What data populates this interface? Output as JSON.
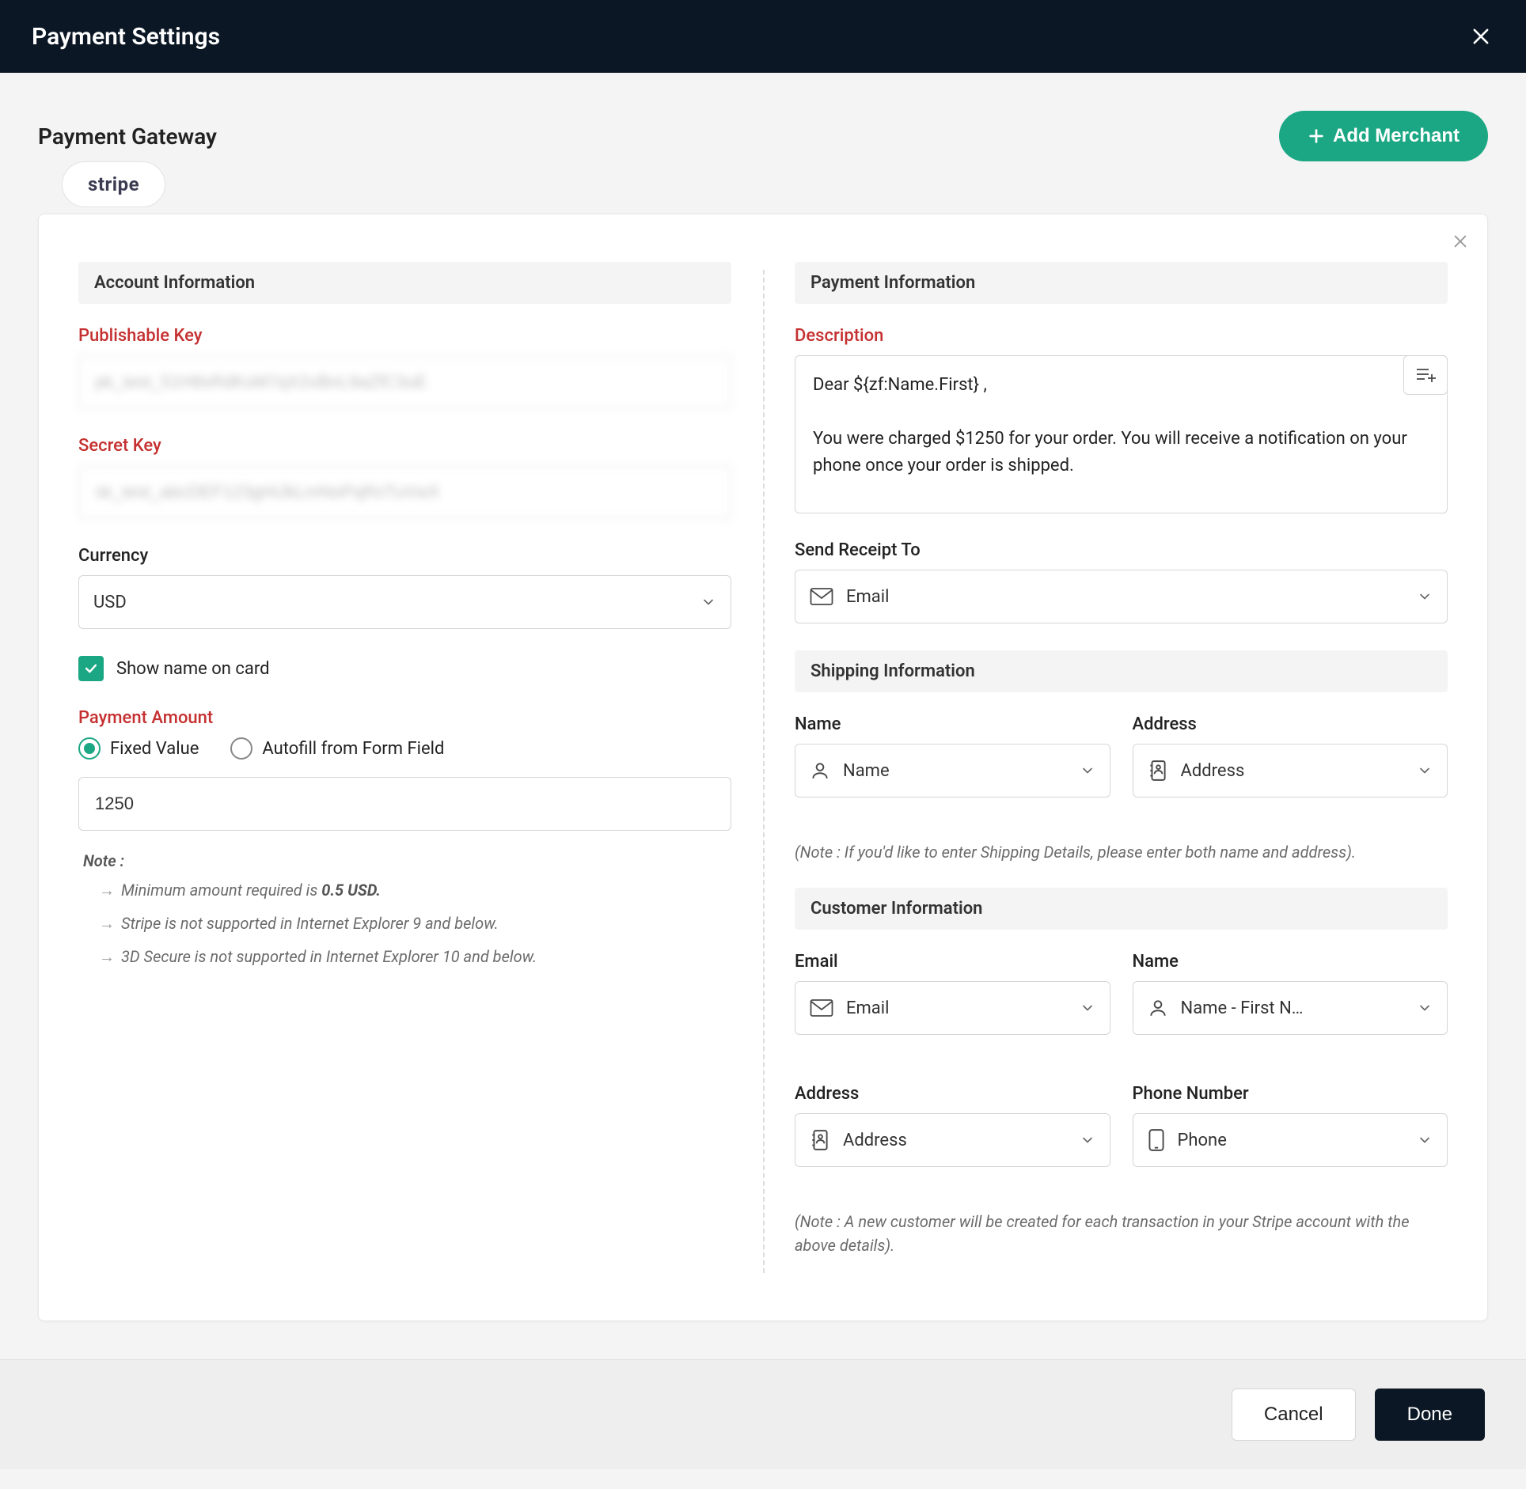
{
  "modal": {
    "title": "Payment Settings"
  },
  "subheader": {
    "title": "Payment Gateway",
    "add_merchant_label": "Add Merchant"
  },
  "chip": {
    "label": "stripe"
  },
  "left": {
    "section_title": "Account Information",
    "publishable_key_label": "Publishable Key",
    "publishable_key_value": "pk_test_51H8sRdKsM7qX2vBnL9aZfC3uE",
    "secret_key_label": "Secret Key",
    "secret_key_value": "sk_test_abcDEF123gHiJkLmNoPqRsTuVwX",
    "currency_label": "Currency",
    "currency_value": "USD",
    "show_name_label": "Show name on card",
    "payment_amount_label": "Payment Amount",
    "radio_fixed": "Fixed Value",
    "radio_autofill": "Autofill from Form Field",
    "amount_value": "1250",
    "note_head": "Note :",
    "notes": [
      {
        "pre": "Minimum amount required is ",
        "strong": "0.5 USD."
      },
      {
        "text": "Stripe is not supported in Internet Explorer 9 and below."
      },
      {
        "text": "3D Secure is not supported in Internet Explorer 10 and below."
      }
    ]
  },
  "right": {
    "section_payment": "Payment Information",
    "description_label": "Description",
    "description_line1": "Dear  ${zf:Name.First} ,",
    "description_line2": "You were charged $1250 for your order. You will receive a notification on your phone once your order is shipped.",
    "send_receipt_label": "Send Receipt To",
    "send_receipt_value": "Email",
    "section_shipping": "Shipping Information",
    "ship_name_label": "Name",
    "ship_name_value": "Name",
    "ship_address_label": "Address",
    "ship_address_value": "Address",
    "shipping_note": "(Note : If you'd like to enter Shipping Details, please enter both name and address).",
    "section_customer": "Customer Information",
    "cust_email_label": "Email",
    "cust_email_value": "Email",
    "cust_name_label": "Name",
    "cust_name_value": "Name - First N…",
    "cust_address_label": "Address",
    "cust_address_value": "Address",
    "cust_phone_label": "Phone Number",
    "cust_phone_value": "Phone",
    "customer_note": "(Note : A new customer will be created for each transaction in your Stripe account with the above details)."
  },
  "footer": {
    "cancel": "Cancel",
    "done": "Done"
  }
}
